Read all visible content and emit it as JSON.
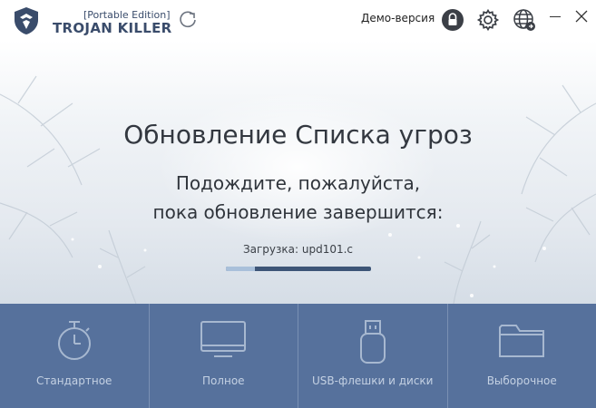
{
  "header": {
    "edition": "[Portable Edition]",
    "brand": "TROJAN KILLER",
    "demo_label": "Демо-версия",
    "icons": [
      "logo-icon",
      "refresh-icon",
      "lock-icon",
      "gear-icon",
      "globe-icon",
      "minimize-icon",
      "close-icon"
    ]
  },
  "hero": {
    "title": "Обновление Списка угроз",
    "line1": "Подождите, пожалуйста,",
    "line2": "пока обновление завершится:",
    "progress_label": "Загрузка: upd101.c",
    "progress": 0.2
  },
  "tiles": [
    {
      "label": "Стандартное",
      "icon": "stopwatch-icon"
    },
    {
      "label": "Полное",
      "icon": "monitor-icon"
    },
    {
      "label": "USB-флешки и диски",
      "icon": "usb-icon"
    },
    {
      "label": "Выборочное",
      "icon": "folder-icon"
    }
  ],
  "colors": {
    "brand": "#3a4c6b",
    "tile_bg": "#56719c",
    "tile_text": "#c4d1e3",
    "progress_track": "#3d5577",
    "progress_fill": "#a9c0da"
  }
}
